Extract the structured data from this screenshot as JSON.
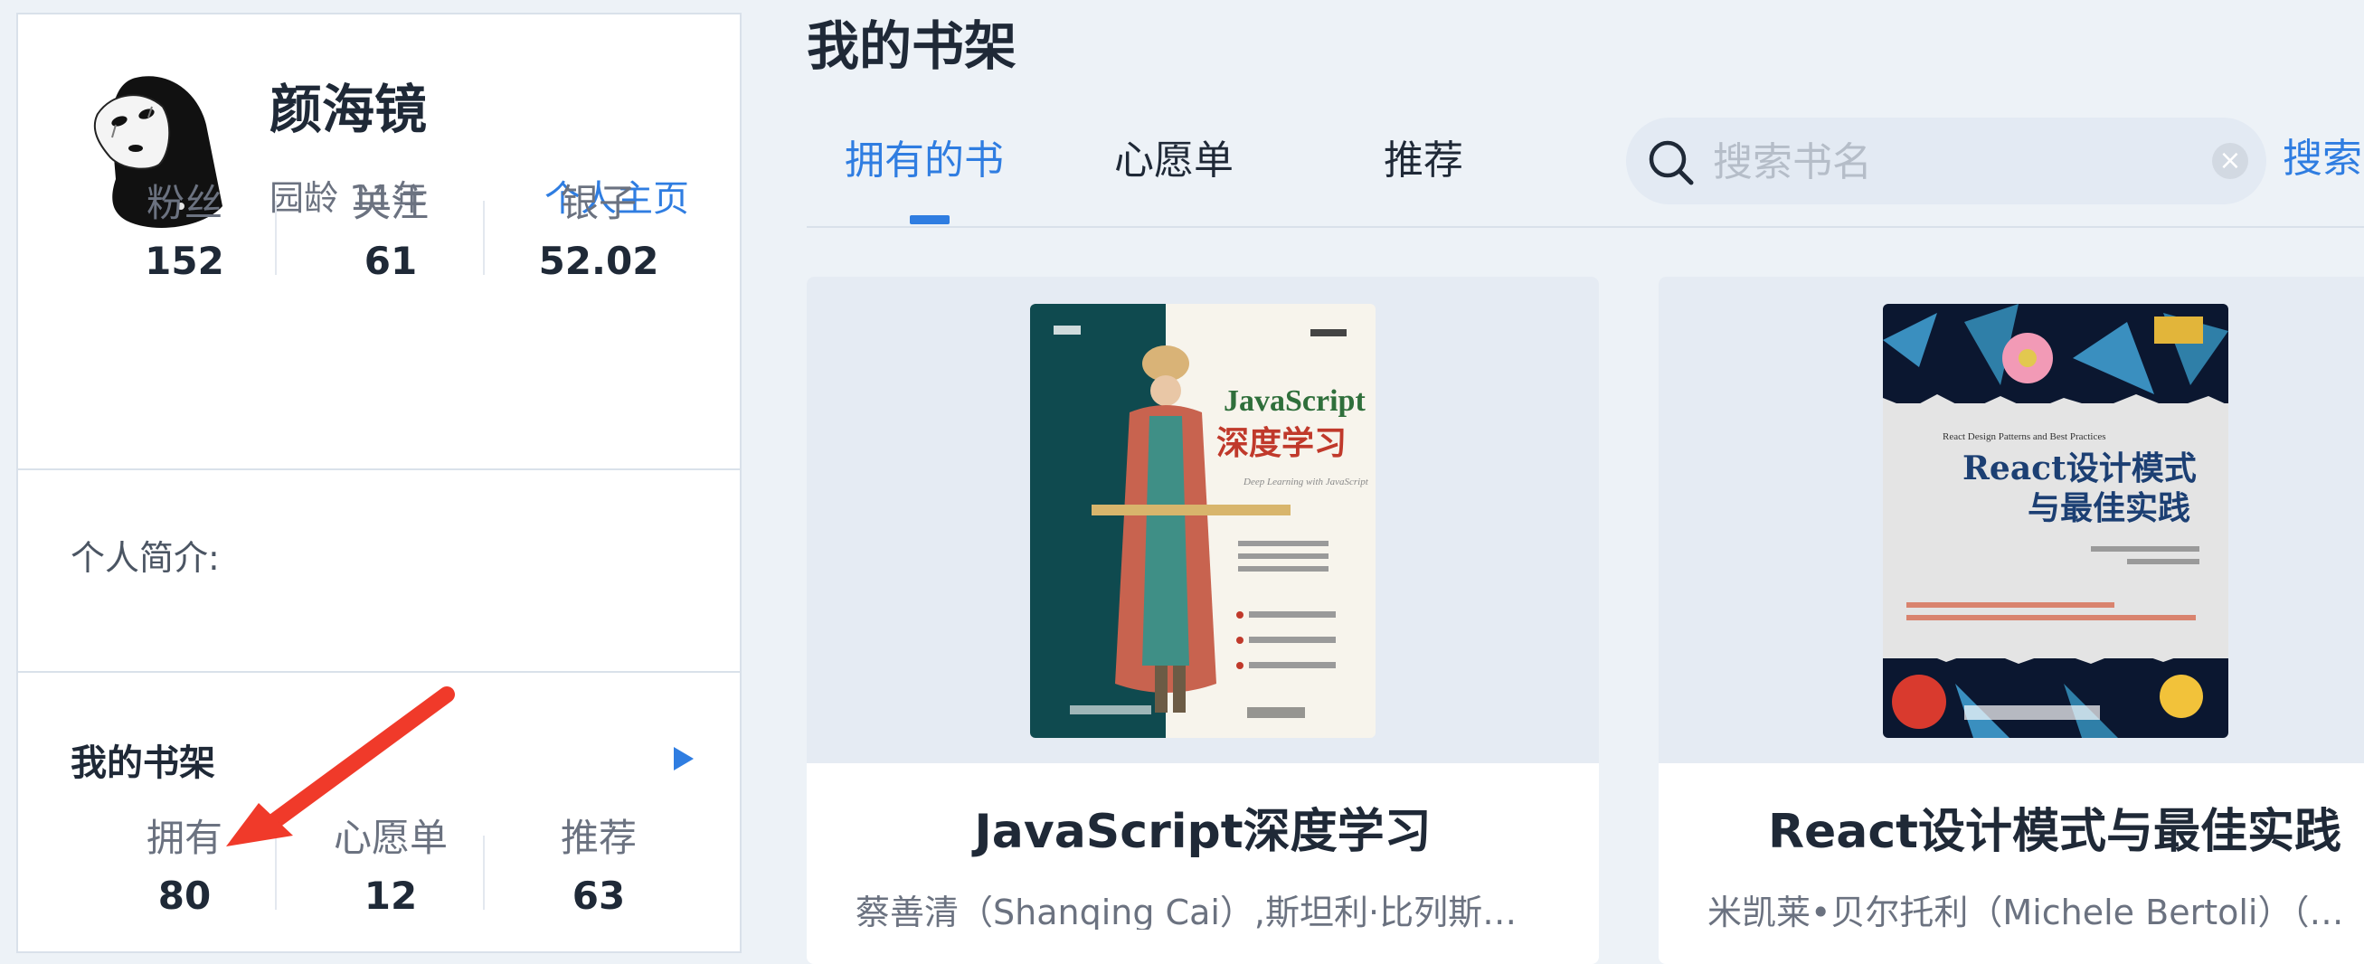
{
  "profile": {
    "username": "颜海镜",
    "age": "园龄 11年",
    "homepage_link": "个人主页",
    "stats": [
      {
        "label": "粉丝",
        "value": "152"
      },
      {
        "label": "关注",
        "value": "61"
      },
      {
        "label": "银子",
        "value": "52.02"
      }
    ],
    "intro_label": "个人简介:"
  },
  "bookshelf_summary": {
    "title": "我的书架",
    "stats": [
      {
        "label": "拥有",
        "value": "80"
      },
      {
        "label": "心愿单",
        "value": "12"
      },
      {
        "label": "推荐",
        "value": "63"
      }
    ]
  },
  "main": {
    "page_title": "我的书架",
    "tabs": [
      {
        "label": "拥有的书",
        "active": true
      },
      {
        "label": "心愿单",
        "active": false
      },
      {
        "label": "推荐",
        "active": false
      }
    ],
    "search": {
      "placeholder": "搜索书名",
      "clear_icon": "×",
      "button_label": "搜索"
    },
    "books": [
      {
        "title": "JavaScript深度学习",
        "author": "蔡善清（Shanqing Cai）,斯坦利·比列斯…",
        "cover": {
          "title_en": "JavaScript",
          "title_cn": "深度学习",
          "subtitle": "Deep Learning with JavaScript"
        }
      },
      {
        "title": "React设计模式与最佳实践",
        "author": "米凯莱•贝尔托利（Michele Bertoli）（…",
        "cover": {
          "subtitle": "React Design Patterns and Best Practices",
          "title_line1": "React设计模式",
          "title_line2": "与最佳实践"
        }
      }
    ]
  },
  "colors": {
    "accent": "#2f7de1",
    "arrow": "#f03a2a",
    "background": "#edf2f7"
  }
}
